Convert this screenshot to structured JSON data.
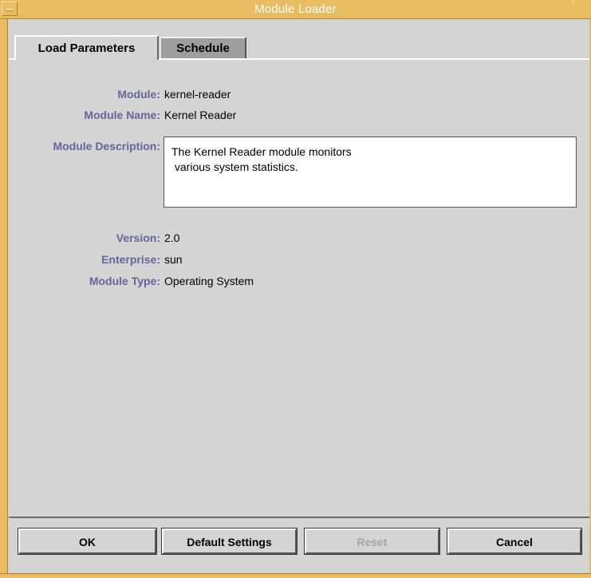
{
  "window": {
    "title": "Module Loader"
  },
  "tabs": [
    {
      "label": "Load Parameters",
      "active": true
    },
    {
      "label": "Schedule",
      "active": false
    }
  ],
  "fields": {
    "module": {
      "label": "Module:",
      "value": "kernel-reader"
    },
    "module_name": {
      "label": "Module Name:",
      "value": "Kernel Reader"
    },
    "module_description": {
      "label": "Module Description:",
      "value": "The Kernel Reader module monitors\n various system statistics."
    },
    "version": {
      "label": "Version:",
      "value": "2.0"
    },
    "enterprise": {
      "label": "Enterprise:",
      "value": "sun"
    },
    "module_type": {
      "label": "Module Type:",
      "value": "Operating System"
    }
  },
  "buttons": {
    "ok": "OK",
    "default_settings": "Default Settings",
    "reset": "Reset",
    "cancel": "Cancel"
  },
  "colors": {
    "title_bar": "#e9bc62",
    "label_text": "#65659a",
    "background": "#d4d4d4"
  }
}
